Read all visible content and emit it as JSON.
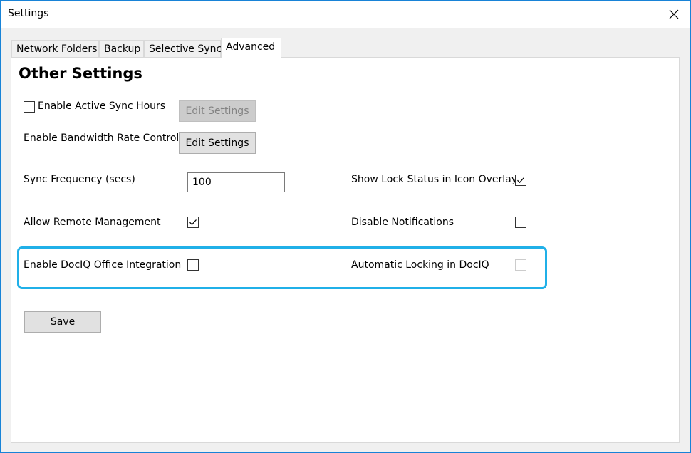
{
  "window": {
    "title": "Settings"
  },
  "tabs": [
    {
      "label": "Network Folders",
      "active": false
    },
    {
      "label": "Backup",
      "active": false
    },
    {
      "label": "Selective Sync",
      "active": false
    },
    {
      "label": "Advanced",
      "active": true
    }
  ],
  "advanced": {
    "heading": "Other Settings",
    "active_sync_hours": {
      "label": "Enable Active Sync Hours",
      "checked": false,
      "button_label": "Edit Settings",
      "button_enabled": false
    },
    "bandwidth": {
      "label": "Enable Bandwidth Rate Control",
      "button_label": "Edit Settings",
      "button_enabled": true
    },
    "sync_frequency": {
      "label": "Sync Frequency (secs)",
      "value": "100"
    },
    "show_lock_status": {
      "label": "Show Lock Status in Icon Overlay",
      "checked": true
    },
    "remote_management": {
      "label": "Allow Remote Management",
      "checked": true
    },
    "disable_notifications": {
      "label": "Disable Notifications",
      "checked": false
    },
    "dociq_office": {
      "label": "Enable DocIQ Office Integration",
      "checked": false
    },
    "auto_locking": {
      "label": "Automatic Locking in DocIQ",
      "checked": false,
      "enabled": false
    },
    "save_label": "Save"
  },
  "colors": {
    "highlight": "#20b0e8",
    "window_border": "#1883d7"
  }
}
